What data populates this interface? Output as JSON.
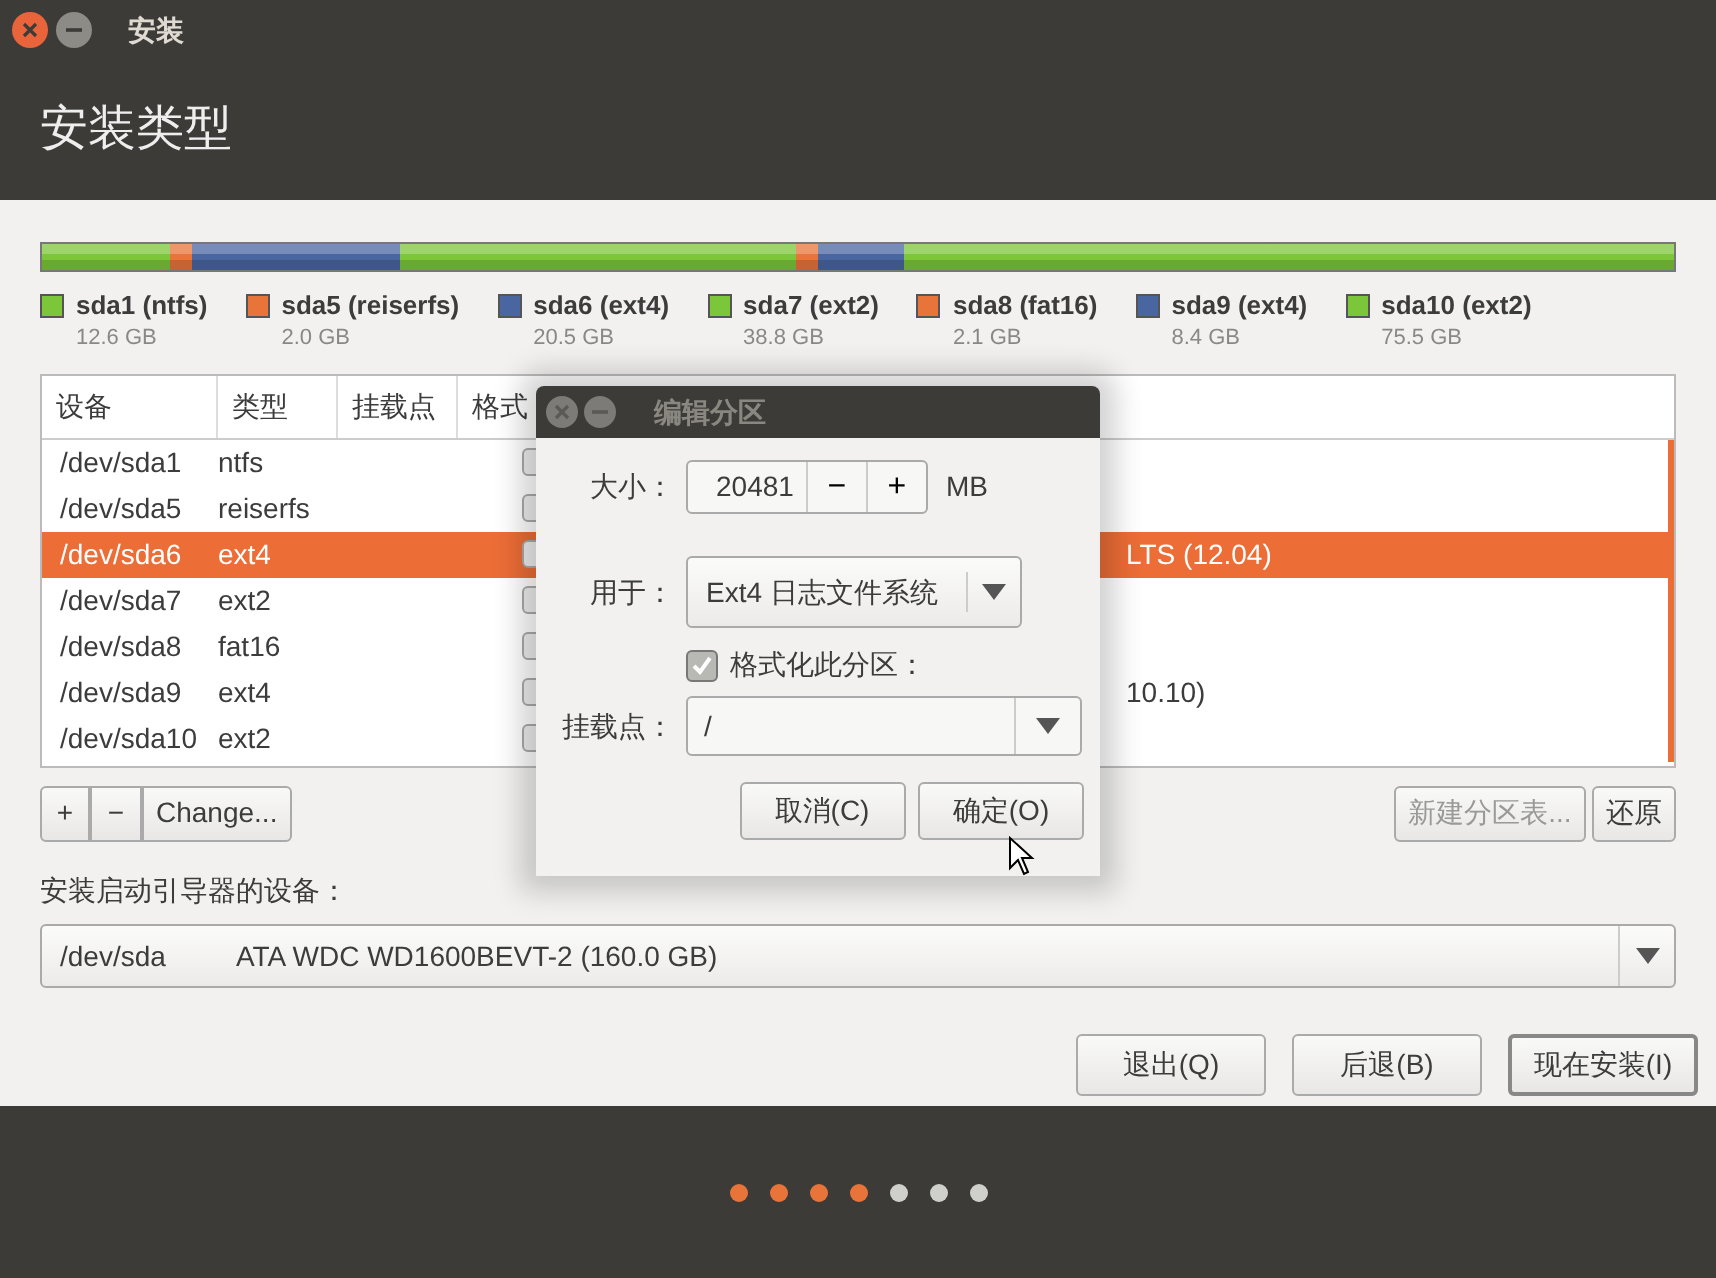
{
  "window": {
    "title": "安装",
    "controls": [
      {
        "kind": "close"
      },
      {
        "kind": "minimize"
      }
    ]
  },
  "header": {
    "title": "安装类型"
  },
  "partitions": [
    {
      "name": "sda1 (ntfs)",
      "size": "12.6 GB",
      "color": "#7cc639"
    },
    {
      "name": "sda5 (reiserfs)",
      "size": "2.0 GB",
      "color": "#e9743a"
    },
    {
      "name": "sda6 (ext4)",
      "size": "20.5 GB",
      "color": "#4a66a0"
    },
    {
      "name": "sda7 (ext2)",
      "size": "38.8 GB",
      "color": "#7cc639"
    },
    {
      "name": "sda8 (fat16)",
      "size": "2.1 GB",
      "color": "#e9743a"
    },
    {
      "name": "sda9 (ext4)",
      "size": "8.4 GB",
      "color": "#4a66a0"
    },
    {
      "name": "sda10 (ext2)",
      "size": "75.5 GB",
      "color": "#7cc639"
    }
  ],
  "table": {
    "columns": [
      "设备",
      "类型",
      "挂载点",
      "格式"
    ],
    "rows": [
      {
        "device": "/dev/sda1",
        "type": "ntfs",
        "selected": false
      },
      {
        "device": "/dev/sda5",
        "type": "reiserfs",
        "selected": false
      },
      {
        "device": "/dev/sda6",
        "type": "ext4",
        "system": "LTS (12.04)",
        "selected": true
      },
      {
        "device": "/dev/sda7",
        "type": "ext2",
        "selected": false
      },
      {
        "device": "/dev/sda8",
        "type": "fat16",
        "selected": false
      },
      {
        "device": "/dev/sda9",
        "type": "ext4",
        "system": "10.10)",
        "selected": false
      },
      {
        "device": "/dev/sda10",
        "type": "ext2",
        "selected": false
      }
    ]
  },
  "table_buttons": [
    {
      "label": "+",
      "disabled": false
    },
    {
      "label": "−",
      "disabled": false
    },
    {
      "label": "Change...",
      "disabled": false
    }
  ],
  "right_buttons": [
    {
      "label": "新建分区表...",
      "disabled": true
    },
    {
      "label": "还原",
      "disabled": false
    }
  ],
  "bootloader": {
    "label": "安装启动引导器的设备：",
    "device": "/dev/sda",
    "description": "ATA WDC WD1600BEVT-2 (160.0 GB)"
  },
  "buttons": [
    {
      "label": "退出(Q)",
      "default": false
    },
    {
      "label": "后退(B)",
      "default": false
    },
    {
      "label": "现在安装(I)",
      "default": true
    }
  ],
  "progress_dots": [
    {
      "done": true
    },
    {
      "done": true
    },
    {
      "done": true
    },
    {
      "done": true
    },
    {
      "done": false
    },
    {
      "done": false
    },
    {
      "done": false
    }
  ],
  "dialog": {
    "title": "编辑分区",
    "size_label": "大小：",
    "size_value": "20481",
    "minus": "−",
    "plus": "+",
    "unit": "MB",
    "use_label": "用于：",
    "use_value": "Ext4 日志文件系统",
    "format": {
      "label": "格式化此分区：",
      "checked": true
    },
    "mount_label": "挂载点：",
    "mount_value": "/",
    "buttons": [
      {
        "label": "取消(C)"
      },
      {
        "label": "确定(O)"
      }
    ]
  }
}
